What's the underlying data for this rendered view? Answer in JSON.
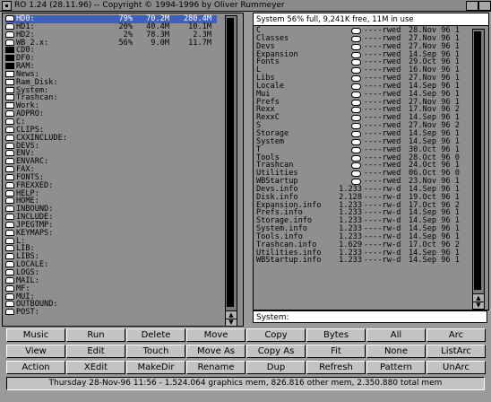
{
  "window": {
    "title": "RO 1.24 (28.11.96) -- Copyright © 1994-1996 by Oliver Rummeyer"
  },
  "left_pane": {
    "devices": [
      {
        "name": "HD0:",
        "pct": "79%",
        "used": "70.2M",
        "free": "280.4M",
        "icon": "disk",
        "selected": true
      },
      {
        "name": "HD1:",
        "pct": "20%",
        "used": "40.4M",
        "free": "10.1M",
        "icon": "disk"
      },
      {
        "name": "HD2:",
        "pct": "2%",
        "used": "78.3M",
        "free": "2.3M",
        "icon": "disk"
      },
      {
        "name": "WB_2.x:",
        "pct": "56%",
        "used": "9.0M",
        "free": "11.7M",
        "icon": "disk"
      },
      {
        "name": "CD0:",
        "icon": "flop"
      },
      {
        "name": "DF0:",
        "icon": "flop"
      },
      {
        "name": "RAM:",
        "icon": "flop"
      },
      {
        "name": "News:",
        "icon": "vol"
      },
      {
        "name": "Ram_Disk:",
        "icon": "vol"
      },
      {
        "name": "System:",
        "icon": "vol"
      },
      {
        "name": "Trashcan:",
        "icon": "vol"
      },
      {
        "name": "Work:",
        "icon": "vol"
      },
      {
        "name": "ADPRO:",
        "icon": "disk"
      },
      {
        "name": "C:",
        "icon": "disk"
      },
      {
        "name": "CLIPS:",
        "icon": "disk"
      },
      {
        "name": "CXXINCLUDE:",
        "icon": "disk"
      },
      {
        "name": "DEVS:",
        "icon": "disk"
      },
      {
        "name": "ENV:",
        "icon": "disk"
      },
      {
        "name": "ENVARC:",
        "icon": "disk"
      },
      {
        "name": "FAX:",
        "icon": "disk"
      },
      {
        "name": "FONTS:",
        "icon": "disk"
      },
      {
        "name": "FREXXED:",
        "icon": "disk"
      },
      {
        "name": "HELP:",
        "icon": "disk"
      },
      {
        "name": "HOME:",
        "icon": "disk"
      },
      {
        "name": "INBOUND:",
        "icon": "disk"
      },
      {
        "name": "INCLUDE:",
        "icon": "disk"
      },
      {
        "name": "JPEGTMP:",
        "icon": "disk"
      },
      {
        "name": "KEYMAPS:",
        "icon": "disk"
      },
      {
        "name": "L:",
        "icon": "disk"
      },
      {
        "name": "LIB:",
        "icon": "disk"
      },
      {
        "name": "LIBS:",
        "icon": "disk"
      },
      {
        "name": "LOCALE:",
        "icon": "disk"
      },
      {
        "name": "LOGS:",
        "icon": "disk"
      },
      {
        "name": "MAIL:",
        "icon": "disk"
      },
      {
        "name": "MF:",
        "icon": "disk"
      },
      {
        "name": "MUI:",
        "icon": "disk"
      },
      {
        "name": "OUTBOUND:",
        "icon": "disk"
      },
      {
        "name": "POST:",
        "icon": "disk"
      }
    ]
  },
  "right_pane": {
    "header": "System  56% full, 9,241K free, 11M in use",
    "path": "System:",
    "entries": [
      {
        "name": "C",
        "size": "",
        "prot": "----rwed",
        "date": "28.Nov 96 1",
        "dir": true
      },
      {
        "name": "Classes",
        "size": "",
        "prot": "----rwed",
        "date": "27.Nov 96 1",
        "dir": true
      },
      {
        "name": "Devs",
        "size": "",
        "prot": "----rwed",
        "date": "27.Nov 96 1",
        "dir": true
      },
      {
        "name": "Expansion",
        "size": "",
        "prot": "----rwed",
        "date": "14.Sep 96 1",
        "dir": true
      },
      {
        "name": "Fonts",
        "size": "",
        "prot": "----rwed",
        "date": "29.Oct 96 1",
        "dir": true
      },
      {
        "name": "L",
        "size": "",
        "prot": "----rwed",
        "date": "16.Nov 96 1",
        "dir": true
      },
      {
        "name": "Libs",
        "size": "",
        "prot": "----rwed",
        "date": "27.Nov 96 1",
        "dir": true
      },
      {
        "name": "Locale",
        "size": "",
        "prot": "----rwed",
        "date": "14.Sep 96 1",
        "dir": true
      },
      {
        "name": "Mui",
        "size": "",
        "prot": "----rwed",
        "date": "14.Sep 96 1",
        "dir": true
      },
      {
        "name": "Prefs",
        "size": "",
        "prot": "----rwed",
        "date": "27.Nov 96 1",
        "dir": true
      },
      {
        "name": "Rexx",
        "size": "",
        "prot": "----rwed",
        "date": "17.Nov 96 2",
        "dir": true
      },
      {
        "name": "RexxC",
        "size": "",
        "prot": "----rwed",
        "date": "14.Sep 96 1",
        "dir": true
      },
      {
        "name": "S",
        "size": "",
        "prot": "----rwed",
        "date": "27.Nov 96 2",
        "dir": true
      },
      {
        "name": "Storage",
        "size": "",
        "prot": "----rwed",
        "date": "14.Sep 96 1",
        "dir": true
      },
      {
        "name": "System",
        "size": "",
        "prot": "----rwed",
        "date": "14.Sep 96 1",
        "dir": true
      },
      {
        "name": "T",
        "size": "",
        "prot": "----rwed",
        "date": "30.Oct 96 1",
        "dir": true
      },
      {
        "name": "Tools",
        "size": "",
        "prot": "----rwed",
        "date": "28.Oct 96 0",
        "dir": true
      },
      {
        "name": "Trashcan",
        "size": "",
        "prot": "----rwed",
        "date": "24.Oct 96 1",
        "dir": true
      },
      {
        "name": "Utilities",
        "size": "",
        "prot": "----rwed",
        "date": "06.Oct 96 0",
        "dir": true
      },
      {
        "name": "WBStartup",
        "size": "",
        "prot": "----rwed",
        "date": "23.Nov 96 1",
        "dir": true
      },
      {
        "name": "Devs.info",
        "size": "1.233",
        "prot": "----rw-d",
        "date": "14.Sep 96 1",
        "dir": false
      },
      {
        "name": "Disk.info",
        "size": "2.128",
        "prot": "----rw-d",
        "date": "19.Oct 96 1",
        "dir": false
      },
      {
        "name": "Expansion.info",
        "size": "1.233",
        "prot": "----rw-d",
        "date": "17.Oct 96 2",
        "dir": false
      },
      {
        "name": "Prefs.info",
        "size": "1.233",
        "prot": "----rw-d",
        "date": "14.Sep 96 1",
        "dir": false
      },
      {
        "name": "Storage.info",
        "size": "1.233",
        "prot": "----rw-d",
        "date": "14.Sep 96 1",
        "dir": false
      },
      {
        "name": "System.info",
        "size": "1.233",
        "prot": "----rw-d",
        "date": "14.Sep 96 1",
        "dir": false
      },
      {
        "name": "Tools.info",
        "size": "1.233",
        "prot": "----rw-d",
        "date": "14.Sep 96 1",
        "dir": false
      },
      {
        "name": "Trashcan.info",
        "size": "1.629",
        "prot": "----rw-d",
        "date": "17.Oct 96 2",
        "dir": false
      },
      {
        "name": "Utilities.info",
        "size": "1.233",
        "prot": "----rw-d",
        "date": "14.Sep 96 1",
        "dir": false
      },
      {
        "name": "WBStartup.info",
        "size": "1.233",
        "prot": "----rw-d",
        "date": "14.Sep 96 1",
        "dir": false
      }
    ]
  },
  "buttons": [
    [
      "Music",
      "Run",
      "Delete",
      "Move",
      "Copy",
      "Bytes",
      "All",
      "Arc"
    ],
    [
      "View",
      "Edit",
      "Touch",
      "Move As",
      "Copy As",
      "Fit",
      "None",
      "ListArc"
    ],
    [
      "Action",
      "XEdit",
      "MakeDir",
      "Rename",
      "Dup",
      "Refresh",
      "Pattern",
      "UnArc"
    ]
  ],
  "status": "Thursday 28-Nov-96 11:56 - 1.524.064 graphics mem, 826.816 other mem, 2.350.880 total mem",
  "colors": {
    "background": "#9a9a9a",
    "selection": "#4060c0",
    "button": "#c3c3c3"
  }
}
